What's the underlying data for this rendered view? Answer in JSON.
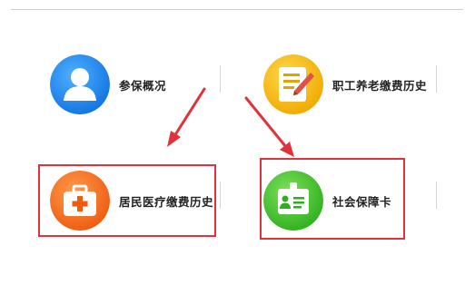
{
  "menu": {
    "items": [
      {
        "id": "overview",
        "label": "参保概况",
        "icon": "person-icon",
        "color": "#1E8CF0"
      },
      {
        "id": "pension",
        "label": "职工养老缴费历史",
        "icon": "document-pencil-icon",
        "color": "#F6B40C"
      },
      {
        "id": "medical",
        "label": "居民医疗缴费历史",
        "icon": "first-aid-kit-icon",
        "color": "#F26A1B"
      },
      {
        "id": "card",
        "label": "社会保障卡",
        "icon": "id-badge-icon",
        "color": "#45C62B"
      }
    ]
  },
  "annotation_color": "#E0313D"
}
